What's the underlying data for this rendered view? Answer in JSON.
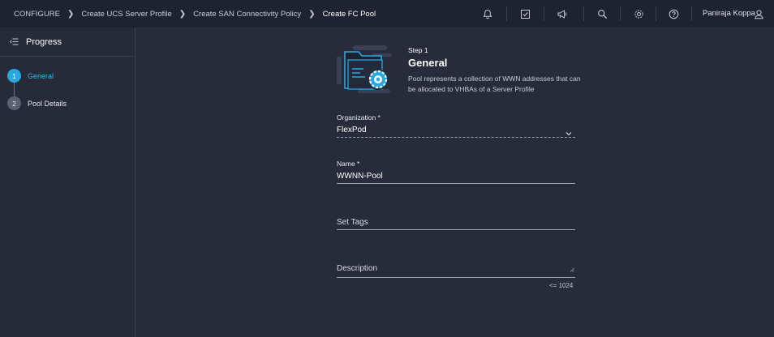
{
  "breadcrumbs": [
    "CONFIGURE",
    "Create UCS Server Profile",
    "Create SAN Connectivity Policy",
    "Create FC Pool"
  ],
  "user": {
    "name": "Paniraja Koppa"
  },
  "topbar_icons": [
    "bell-icon",
    "task-check-icon",
    "megaphone-icon",
    "search-icon",
    "gear-icon",
    "help-icon",
    "user-icon"
  ],
  "sidebar": {
    "title": "Progress",
    "steps": [
      {
        "number": "1",
        "label": "General",
        "state": "active"
      },
      {
        "number": "2",
        "label": "Pool Details",
        "state": "inactive"
      }
    ]
  },
  "step": {
    "label": "Step 1",
    "title": "General",
    "description": "Pool represents a collection of WWN addresses that can be allocated to VHBAs of a Server Profile"
  },
  "form": {
    "organization": {
      "label": "Organization *",
      "value": "FlexPod"
    },
    "name": {
      "label": "Name *",
      "value": "WWNN-Pool"
    },
    "tags": {
      "placeholder": "Set Tags"
    },
    "description": {
      "placeholder": "Description",
      "counter": "<= 1024"
    }
  },
  "colors": {
    "accent": "#2aa7df",
    "background": "#272b3a",
    "topbar": "#1f2331"
  }
}
